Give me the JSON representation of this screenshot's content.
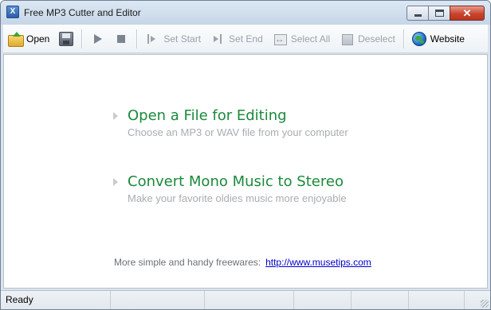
{
  "window": {
    "title": "Free MP3 Cutter and Editor",
    "app_icon_glyph": "X",
    "controls": {
      "minimize": "minimize-icon",
      "maximize": "maximize-icon",
      "close": "close-icon",
      "close_glyph": "✕"
    }
  },
  "toolbar": {
    "items": [
      {
        "id": "open",
        "label": "Open",
        "icon": "open-folder-icon",
        "enabled": true
      },
      {
        "id": "save",
        "label": "",
        "icon": "save-icon",
        "enabled": true
      },
      {
        "id": "play",
        "label": "",
        "icon": "play-icon",
        "enabled": true
      },
      {
        "id": "stop",
        "label": "",
        "icon": "stop-icon",
        "enabled": true
      },
      {
        "id": "set_start",
        "label": "Set Start",
        "icon": "set-start-icon",
        "enabled": false
      },
      {
        "id": "set_end",
        "label": "Set End",
        "icon": "set-end-icon",
        "enabled": false
      },
      {
        "id": "select_all",
        "label": "Select All",
        "icon": "select-all-icon",
        "enabled": false
      },
      {
        "id": "deselect",
        "label": "Deselect",
        "icon": "deselect-icon",
        "enabled": false
      },
      {
        "id": "website",
        "label": "Website",
        "icon": "globe-icon",
        "enabled": true
      }
    ]
  },
  "main": {
    "tasks": [
      {
        "heading": "Open a File for Editing",
        "description": "Choose an MP3 or WAV file from your computer"
      },
      {
        "heading": "Convert Mono Music to Stereo",
        "description": "Make your favorite oldies music more enjoyable"
      }
    ],
    "footer": {
      "text": "More simple and handy freewares:",
      "link": "http://www.musetips.com"
    }
  },
  "status": {
    "text": "Ready"
  },
  "colors": {
    "heading_green": "#1a8a3c",
    "subtext_gray": "#a9adb1",
    "link_blue": "#0000cc"
  }
}
